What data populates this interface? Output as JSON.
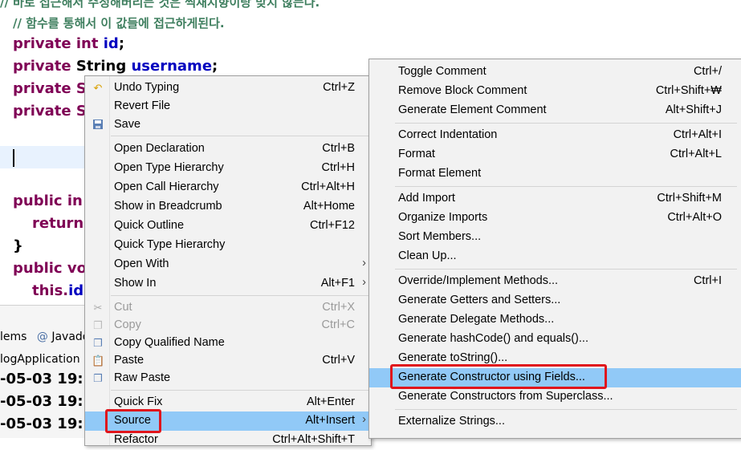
{
  "editor": {
    "comment_lines": [
      "// 바로 접근해서 수정해버리는 것은 썩재지향이랑 맞지 않는다.",
      "// 함수를 통해서 이 값들에 접근하게된다."
    ],
    "line1": {
      "kw": "private int ",
      "field": "id",
      "rest": ";"
    },
    "line2": {
      "kw": "private ",
      "type": "String ",
      "field": "username",
      "rest": ";"
    },
    "line3": {
      "kw": "private S"
    },
    "line4": {
      "kw": "private S"
    },
    "line5": {
      "kw": "public in"
    },
    "line6": {
      "kw": "return"
    },
    "line7": {
      "text": "}"
    },
    "line8": {
      "kw": "public vo"
    },
    "line9": {
      "kw": "this.",
      "field": "id"
    }
  },
  "bottom_panel": {
    "tabs": [
      "lems",
      "@",
      "Javado"
    ],
    "app_name": "logApplication",
    "log_lines": [
      "-05-03 19:1",
      "-05-03 19:1",
      "-05-03 19:1"
    ]
  },
  "main_menu": {
    "items": [
      {
        "label": "Undo Typing",
        "accel": "Ctrl+Z",
        "icon": "undo-icon"
      },
      {
        "label": "Revert File",
        "accel": ""
      },
      {
        "label": "Save",
        "accel": "",
        "icon": "save-icon"
      },
      {
        "label": "Open Declaration",
        "accel": "Ctrl+B"
      },
      {
        "label": "Open Type Hierarchy",
        "accel": "Ctrl+H"
      },
      {
        "label": "Open Call Hierarchy",
        "accel": "Ctrl+Alt+H"
      },
      {
        "label": "Show in Breadcrumb",
        "accel": "Alt+Home"
      },
      {
        "label": "Quick Outline",
        "accel": "Ctrl+F12"
      },
      {
        "label": "Quick Type Hierarchy",
        "accel": ""
      },
      {
        "label": "Open With",
        "accel": "",
        "arrow": "›"
      },
      {
        "label": "Show In",
        "accel": "Alt+F1",
        "arrow": "›"
      },
      {
        "label": "Cut",
        "accel": "Ctrl+X",
        "icon": "cut-icon"
      },
      {
        "label": "Copy",
        "accel": "Ctrl+C",
        "icon": "copy-icon"
      },
      {
        "label": "Copy Qualified Name",
        "accel": "",
        "icon": "copy-qualified-icon"
      },
      {
        "label": "Paste",
        "accel": "Ctrl+V",
        "icon": "paste-icon"
      },
      {
        "label": "Raw Paste",
        "accel": "",
        "icon": "raw-paste-icon"
      },
      {
        "label": "Quick Fix",
        "accel": "Alt+Enter"
      },
      {
        "label": "Source",
        "accel": "Alt+Insert",
        "arrow": "›"
      },
      {
        "label": "Refactor",
        "accel": "Ctrl+Alt+Shift+T"
      }
    ]
  },
  "sub_menu": {
    "items": [
      {
        "label": "Toggle Comment",
        "accel": "Ctrl+/"
      },
      {
        "label": "Remove Block Comment",
        "accel": "Ctrl+Shift+₩"
      },
      {
        "label": "Generate Element Comment",
        "accel": "Alt+Shift+J"
      },
      {
        "label": "Correct Indentation",
        "accel": "Ctrl+Alt+I"
      },
      {
        "label": "Format",
        "accel": "Ctrl+Alt+L"
      },
      {
        "label": "Format Element",
        "accel": ""
      },
      {
        "label": "Add Import",
        "accel": "Ctrl+Shift+M"
      },
      {
        "label": "Organize Imports",
        "accel": "Ctrl+Alt+O"
      },
      {
        "label": "Sort Members...",
        "accel": ""
      },
      {
        "label": "Clean Up...",
        "accel": ""
      },
      {
        "label": "Override/Implement Methods...",
        "accel": "Ctrl+I"
      },
      {
        "label": "Generate Getters and Setters...",
        "accel": ""
      },
      {
        "label": "Generate Delegate Methods...",
        "accel": ""
      },
      {
        "label": "Generate hashCode() and equals()...",
        "accel": ""
      },
      {
        "label": "Generate toString()...",
        "accel": ""
      },
      {
        "label": "Generate Constructor using Fields...",
        "accel": ""
      },
      {
        "label": "Generate Constructors from Superclass...",
        "accel": ""
      },
      {
        "label": "Externalize Strings...",
        "accel": ""
      }
    ]
  },
  "colors": {
    "highlight": "#91c9f7",
    "annotation": "#e0151c",
    "keyword": "#7f0055",
    "field": "#0000c0",
    "comment": "#3f7f5f"
  }
}
